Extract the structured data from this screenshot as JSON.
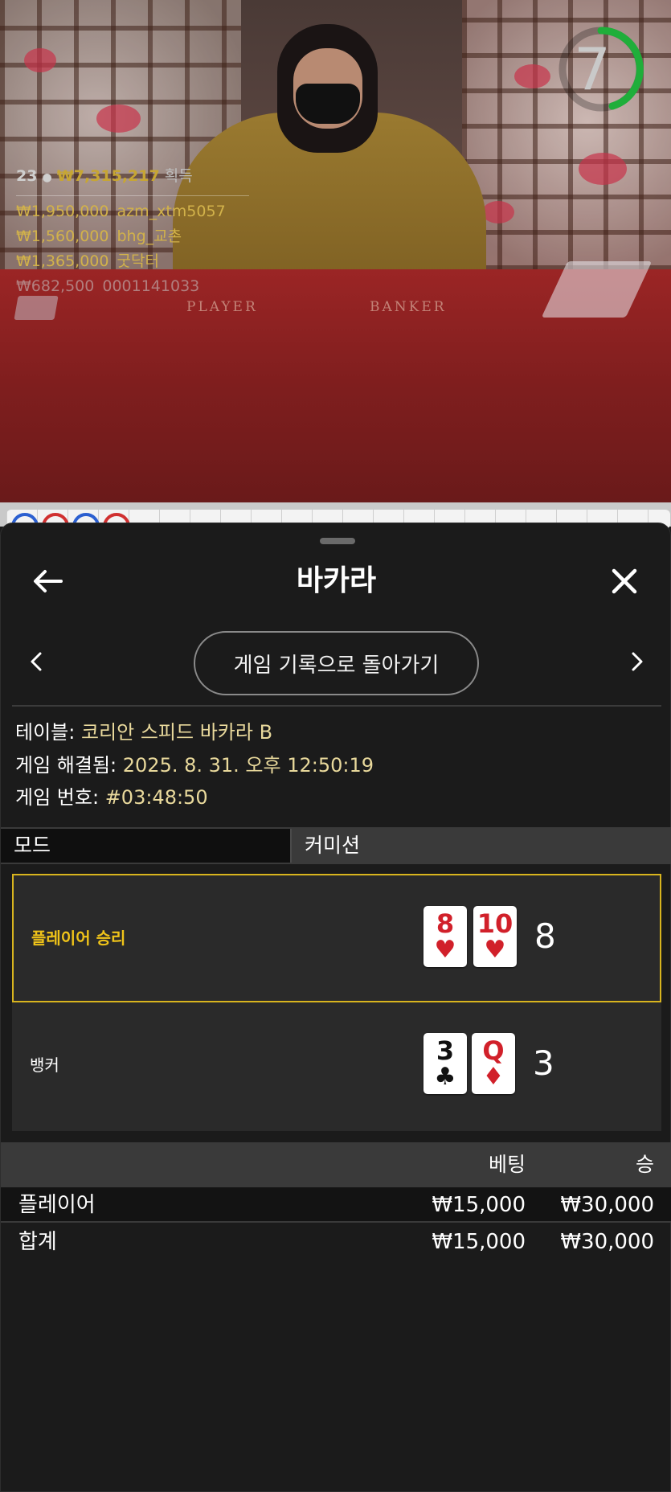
{
  "video": {
    "timer": "7",
    "table_words": {
      "player": "PLAYER",
      "banker": "BANKER"
    },
    "winners": {
      "count": "23",
      "total": "₩7,315,217",
      "earned_label": "획득",
      "list": [
        {
          "amount": "₩1,950,000",
          "name": "azm_xtm5057"
        },
        {
          "amount": "₩1,560,000",
          "name": "bhg_교촌"
        },
        {
          "amount": "₩1,365,000",
          "name": "굿닥터"
        },
        {
          "amount": "₩682,500",
          "name": "0001141033"
        }
      ]
    }
  },
  "sheet": {
    "title": "바카라",
    "back_to_history": "게임 기록으로 돌아가기",
    "info": {
      "table_key": "테이블:",
      "table_value": "코리안 스피드 바카라 B",
      "resolved_key": "게임 해결됨:",
      "resolved_value": "2025. 8. 31. 오후 12:50:19",
      "number_key": "게임 번호:",
      "number_value": "#03:48:50"
    },
    "tabs": {
      "mode": "모드",
      "commission": "커미션"
    },
    "results": [
      {
        "label": "플레이어 승리",
        "cards": [
          {
            "rank": "8",
            "suit": "♥"
          },
          {
            "rank": "10",
            "suit": "♥"
          }
        ],
        "score": "8"
      },
      {
        "label": "뱅커",
        "cards": [
          {
            "rank": "3",
            "suit": "♣"
          },
          {
            "rank": "Q",
            "suit": "♦"
          }
        ],
        "score": "3"
      }
    ],
    "bets": {
      "head": {
        "bet": "베팅",
        "win": "승"
      },
      "player": {
        "name": "플레이어",
        "bet": "₩15,000",
        "win": "₩30,000"
      },
      "total": {
        "name": "합계",
        "bet": "₩15,000",
        "win": "₩30,000"
      }
    }
  },
  "colors": {
    "accent_gold": "#f0c419",
    "timer_green": "#1fae3a",
    "card_red": "#d1202a"
  }
}
